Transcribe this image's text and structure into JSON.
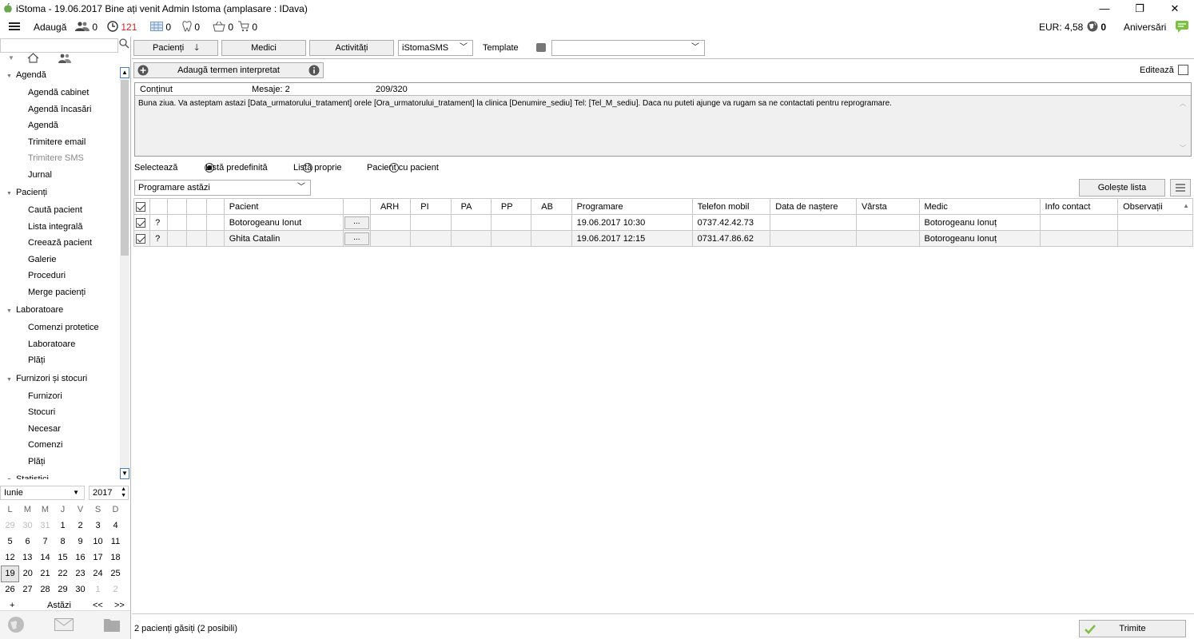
{
  "window": {
    "title": "iStoma - 19.06.2017 Bine ați venit Admin Istoma (amplasare : IDava)",
    "minimize": "—",
    "restore": "❐",
    "close": "✕"
  },
  "toolbar": {
    "add_label": "Adaugă",
    "users_count": "0",
    "clock_count": "121",
    "calendar_count": "0",
    "tooth_count": "0",
    "basket_count": "0",
    "cart_count": "0",
    "eur_rate": "EUR: 4,58",
    "globe_count": "0",
    "birthdays_label": "Aniversări",
    "accent_red": "#e02020"
  },
  "sidebar": {
    "groups": [
      {
        "label": "Agendă",
        "items": [
          "Agendă cabinet",
          "Agendă încasări",
          "Agendă",
          "Trimitere email",
          "Trimitere SMS",
          "Jurnal"
        ]
      },
      {
        "label": "Pacienți",
        "items": [
          "Caută pacient",
          "Lista integrală",
          "Creează pacient",
          "Galerie",
          "Proceduri",
          "Merge pacienți"
        ]
      },
      {
        "label": "Laboratoare",
        "items": [
          "Comenzi protetice",
          "Laboratoare",
          "Plăți"
        ]
      },
      {
        "label": "Furnizori și stocuri",
        "items": [
          "Furnizori",
          "Stocuri",
          "Necesar",
          "Comenzi",
          "Plăți"
        ]
      },
      {
        "label": "Statistici",
        "items": []
      }
    ],
    "selected_item": "Trimitere SMS"
  },
  "calendar": {
    "month": "Iunie",
    "year": "2017",
    "weekdays": [
      "L",
      "M",
      "M",
      "J",
      "V",
      "S",
      "D"
    ],
    "weeks": [
      [
        "29",
        "30",
        "31",
        "1",
        "2",
        "3",
        "4"
      ],
      [
        "5",
        "6",
        "7",
        "8",
        "9",
        "10",
        "11"
      ],
      [
        "12",
        "13",
        "14",
        "15",
        "16",
        "17",
        "18"
      ],
      [
        "19",
        "20",
        "21",
        "22",
        "23",
        "24",
        "25"
      ],
      [
        "26",
        "27",
        "28",
        "29",
        "30",
        "1",
        "2"
      ]
    ],
    "today": "19",
    "plus": "+",
    "today_label": "Astăzi",
    "prev": "<<",
    "next": ">>"
  },
  "main": {
    "btn_pacienti": "Pacienți",
    "btn_medici": "Medici",
    "btn_activitati": "Activități",
    "sms_provider": "iStomaSMS",
    "template_label": "Template",
    "template_value": "",
    "add_term_label": "Adaugă termen interpretat",
    "edit_label": "Editează",
    "content_label": "Conținut",
    "messages_label": "Mesaje: 2",
    "char_count": "209/320",
    "message_text": "Buna ziua. Va asteptam astazi [Data_urmatorului_tratament] orele [Ora_urmatorului_tratament] la clinica [Denumire_sediu] Tel: [Tel_M_sediu]. Daca nu puteti ajunge va rugam sa ne contactati pentru reprogramare.",
    "select_label": "Selectează",
    "radio_predefined": "Listă predefinită",
    "radio_own": "Listă proprie",
    "radio_patient": "Pacient cu pacient",
    "list_choice": "Programare astăzi",
    "clear_list": "Golește lista",
    "status_text": "2 pacienți găsiți (2 posibili)",
    "send_label": "Trimite"
  },
  "table": {
    "headers": [
      "",
      "",
      "",
      "",
      "",
      "Pacient",
      "",
      "ARH",
      "PI",
      "PA",
      "PP",
      "AB",
      "Programare",
      "Telefon mobil",
      "Data de naștere",
      "Vârsta",
      "Medic",
      "Info contact",
      "Observații"
    ],
    "rows": [
      {
        "q": "?",
        "pacient": "Botorogeanu Ionut",
        "dots": "...",
        "programare": "19.06.2017 10:30",
        "telefon": "0737.42.42.73",
        "medic": "Botorogeanu Ionuț"
      },
      {
        "q": "?",
        "pacient": "Ghita Catalin",
        "dots": "...",
        "programare": "19.06.2017 12:15",
        "telefon": "0731.47.86.62",
        "medic": "Botorogeanu Ionuț"
      }
    ]
  }
}
